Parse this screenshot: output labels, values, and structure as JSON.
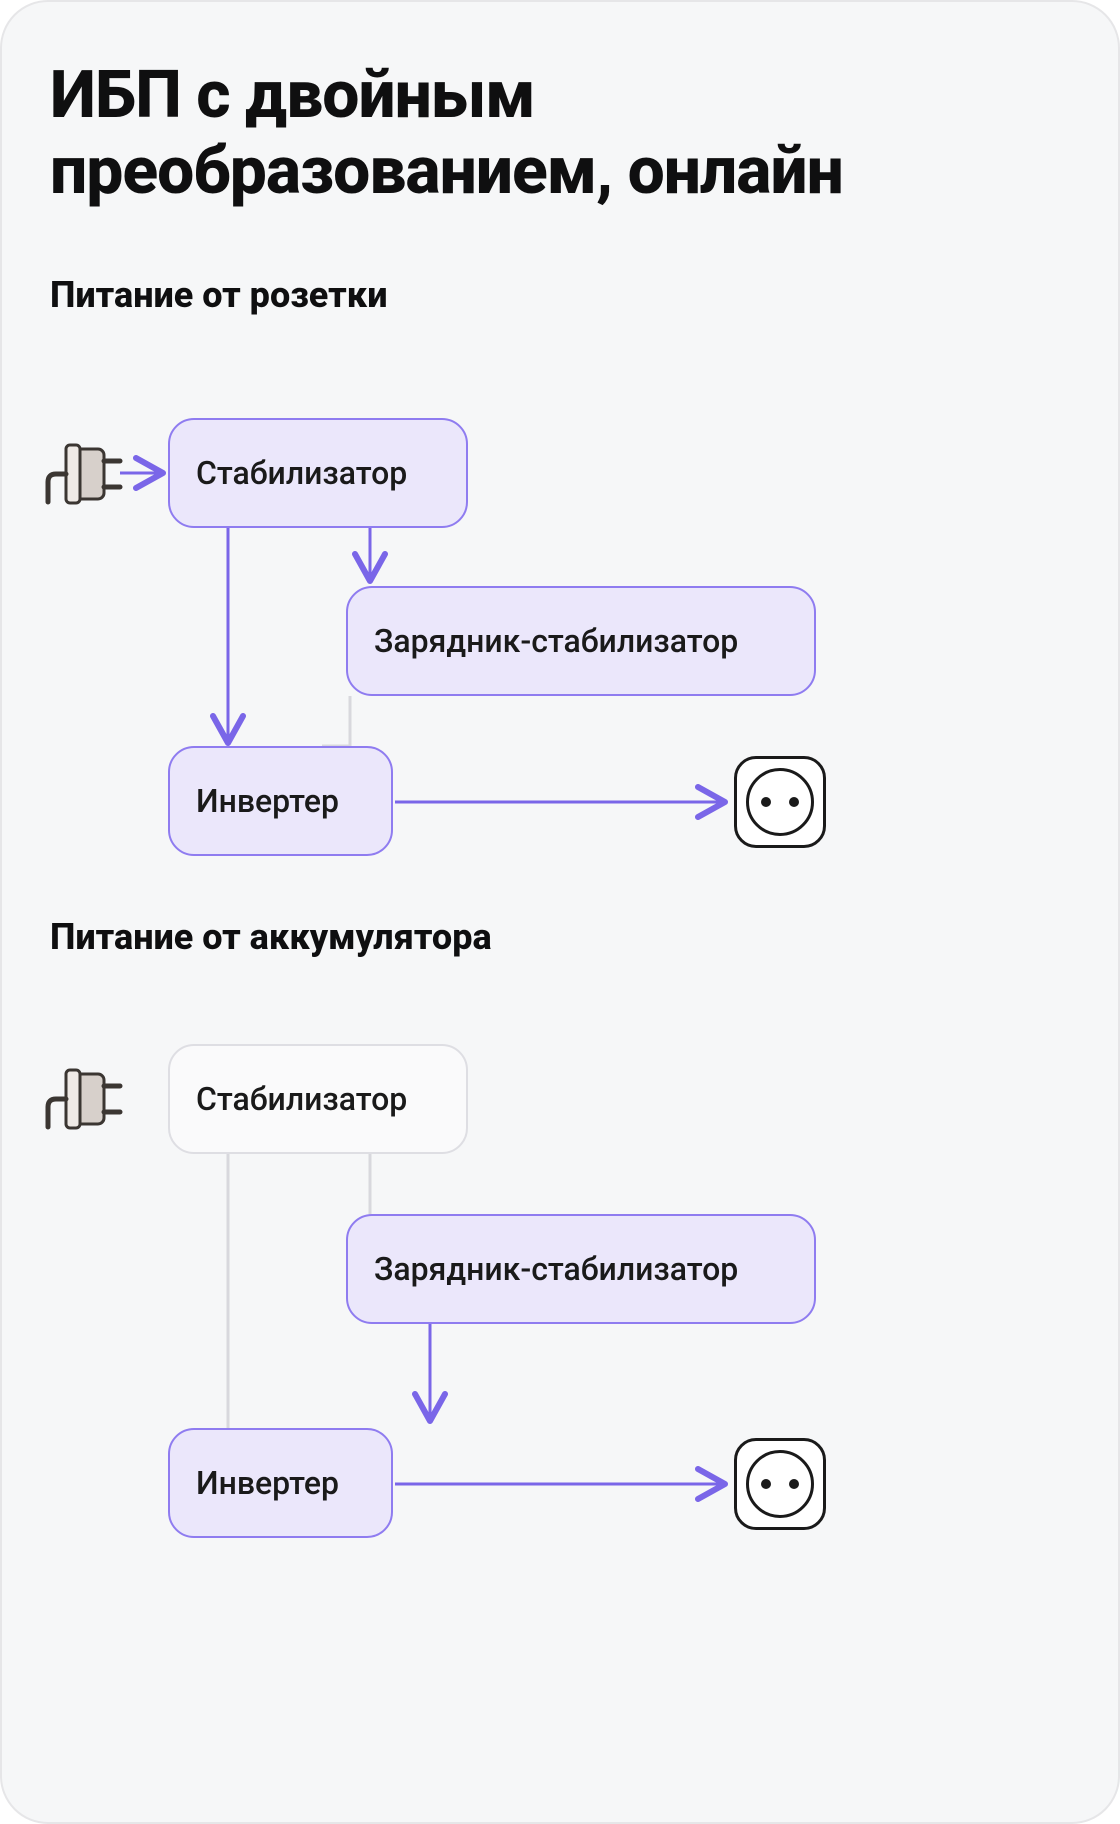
{
  "title": "ИБП с двойным преобразованием, онлайн",
  "sections": {
    "mains": {
      "subtitle": "Питание от розетки",
      "nodes": {
        "stabilizer": "Стабилизатор",
        "charger": "Зарядник-стабилизатор",
        "inverter": "Инвертер"
      }
    },
    "battery": {
      "subtitle": "Питание от аккумулятора",
      "nodes": {
        "stabilizer": "Стабилизатор",
        "charger": "Зарядник-стабилизатор",
        "inverter": "Инвертер"
      }
    }
  },
  "colors": {
    "activeFill": "#ebe7fb",
    "activeStroke": "#8f7cf0",
    "inactiveFill": "#fafafb",
    "inactiveStroke": "#dedee3",
    "arrowActive": "#7a66e8",
    "arrowInactive": "#d8d8dd"
  },
  "icons": {
    "plug": "plug-icon",
    "socket": "socket-icon"
  }
}
